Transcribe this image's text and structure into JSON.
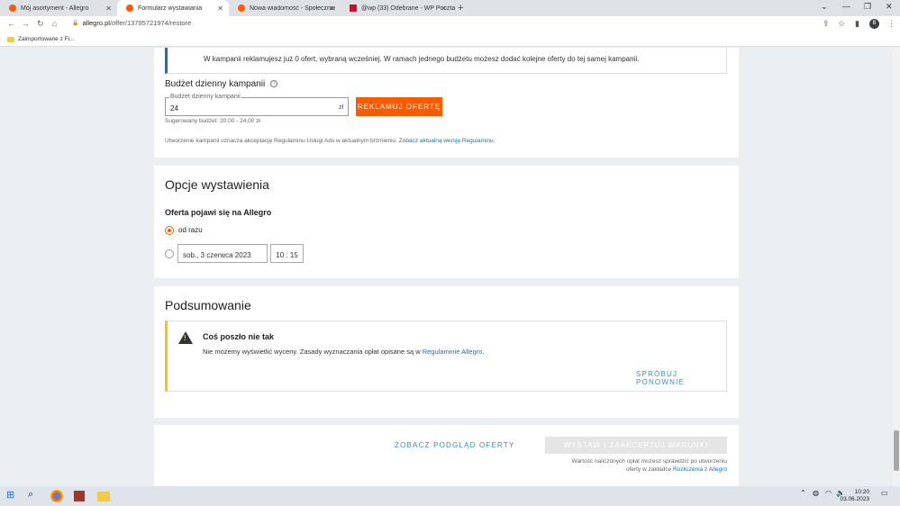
{
  "browser": {
    "tabs": [
      {
        "label": "Mój asortyment - Allegro",
        "color": "#ff5a00"
      },
      {
        "label": "Formularz wystawiania",
        "color": "#ff5a00"
      },
      {
        "label": "Nowa wiadomość - Społeczność",
        "color": "#ff5a00"
      },
      {
        "label": "@wp (33) Odebrane - WP Poczta",
        "color": "#c8102e"
      }
    ],
    "url_domain": "allegro.pl",
    "url_path": "/offer/13795721974/restore",
    "bookmark": "Zaimportowane z Fi...",
    "avatar_letter": "B"
  },
  "campaign": {
    "info_text": "W kampanii reklamujesz już 0 ofert, wybraną wcześniej. W ramach jednego budżetu możesz dodać kolejne oferty do tej samej kampanii.",
    "budget_title": "Budżet dzienny kampanii",
    "budget_legend": "Budżet dzienny kampanii",
    "budget_value": "24",
    "budget_currency": "zł",
    "promote_button": "REKLAMUJ OFERTĘ",
    "suggested": "Sugerowany budżet: 20,00 - 24,00 zł",
    "terms_text": "Utworzenie kampanii oznacza akceptację Regulaminu Usługi Ads w aktualnym brzmieniu.",
    "terms_link": "Zobacz aktualną wersję Regulaminu."
  },
  "options": {
    "title": "Opcje wystawienia",
    "subtitle": "Oferta pojawi się na Allegro",
    "now_label": "od razu",
    "date_value": "sob., 3 czerwca 2023",
    "time_value": "10 : 15"
  },
  "summary": {
    "title": "Podsumowanie",
    "error_title": "Coś poszło nie tak",
    "error_text": "Nie możemy wyświetlić wyceny. Zasady wyznaczania opłat opisane są w",
    "error_link": "Regulaminie Allegro",
    "retry": "SPRÓBUJ PONOWNIE"
  },
  "footer": {
    "preview": "ZOBACZ PODGLĄD OFERTY",
    "submit": "WYSTAW I ZAAKCEPTUJ WARUNKI",
    "fee_note_1": "Wartość naliczonych opłat możesz sprawdzić po utworzeniu",
    "fee_note_2": "oferty w zakładce",
    "fee_link": "Rozliczenia z Allegro"
  },
  "taskbar": {
    "time": "10:20",
    "date": "03.06.2023"
  }
}
